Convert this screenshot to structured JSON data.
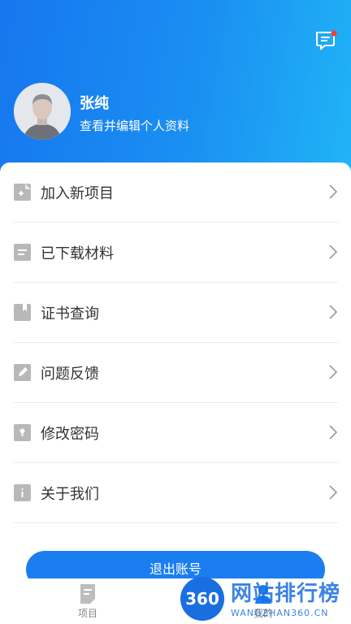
{
  "header": {
    "gradient": [
      "#1677ee",
      "#20b4f6"
    ],
    "message_icon": "message-icon",
    "has_unread_dot": true,
    "unread_dot_color": "#ff3b30"
  },
  "profile": {
    "name": "张纯",
    "subtitle": "查看并编辑个人资料",
    "avatar_icon": "user-avatar"
  },
  "menu": {
    "items": [
      {
        "label": "加入新项目",
        "icon": "add-document-icon"
      },
      {
        "label": "已下载材料",
        "icon": "document-icon"
      },
      {
        "label": "证书查询",
        "icon": "certificate-icon"
      },
      {
        "label": "问题反馈",
        "icon": "edit-icon"
      },
      {
        "label": "修改密码",
        "icon": "lock-icon"
      },
      {
        "label": "关于我们",
        "icon": "info-icon"
      }
    ]
  },
  "logout": {
    "label": "退出账号",
    "color": "#1a7ef0"
  },
  "tabbar": {
    "items": [
      {
        "label": "项目",
        "icon": "project-icon",
        "active": false
      },
      {
        "label": "我的",
        "icon": "profile-icon",
        "active": true
      }
    ]
  },
  "watermark": {
    "badge": "360",
    "title": "网站排行榜",
    "url": "WANGZHAN360.CN"
  }
}
